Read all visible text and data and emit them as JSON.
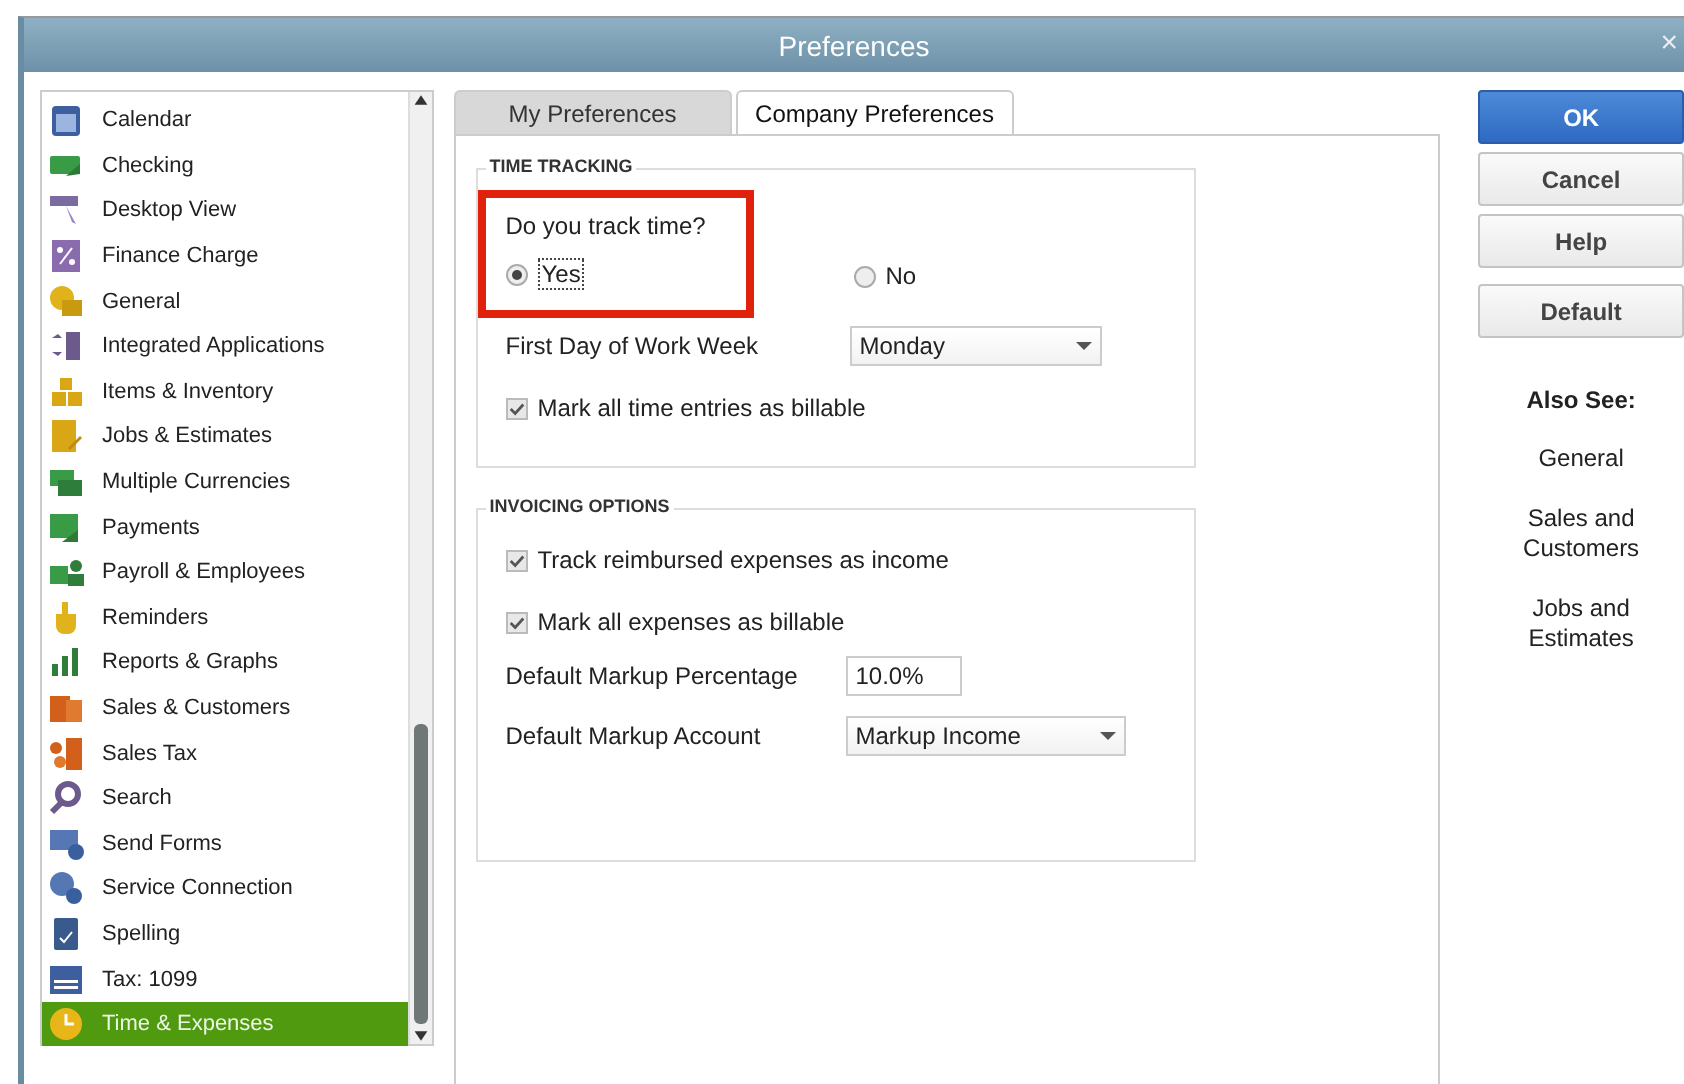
{
  "window": {
    "title": "Preferences",
    "close": "×"
  },
  "sidebar": {
    "items": [
      {
        "label": "Calendar",
        "selected": false
      },
      {
        "label": "Checking",
        "selected": false
      },
      {
        "label": "Desktop View",
        "selected": false
      },
      {
        "label": "Finance Charge",
        "selected": false
      },
      {
        "label": "General",
        "selected": false
      },
      {
        "label": "Integrated Applications",
        "selected": false
      },
      {
        "label": "Items & Inventory",
        "selected": false
      },
      {
        "label": "Jobs & Estimates",
        "selected": false
      },
      {
        "label": "Multiple Currencies",
        "selected": false
      },
      {
        "label": "Payments",
        "selected": false
      },
      {
        "label": "Payroll & Employees",
        "selected": false
      },
      {
        "label": "Reminders",
        "selected": false
      },
      {
        "label": "Reports & Graphs",
        "selected": false
      },
      {
        "label": "Sales & Customers",
        "selected": false
      },
      {
        "label": "Sales Tax",
        "selected": false
      },
      {
        "label": "Search",
        "selected": false
      },
      {
        "label": "Send Forms",
        "selected": false
      },
      {
        "label": "Service Connection",
        "selected": false
      },
      {
        "label": "Spelling",
        "selected": false
      },
      {
        "label": "Tax: 1099",
        "selected": false
      },
      {
        "label": "Time & Expenses",
        "selected": true
      }
    ]
  },
  "tabs": [
    {
      "label": "My Preferences",
      "selected": false
    },
    {
      "label": "Company Preferences",
      "selected": true
    }
  ],
  "time_tracking": {
    "title": "TIME TRACKING",
    "question": "Do you track time?",
    "highlighted": true,
    "options": [
      {
        "label": "Yes",
        "selected": true
      },
      {
        "label": "No",
        "selected": false
      }
    ],
    "first_day": {
      "label": "First Day of Work Week",
      "value": "Monday"
    },
    "billable": {
      "label": "Mark all time entries as billable",
      "checked": true
    }
  },
  "invoicing": {
    "title": "INVOICING OPTIONS",
    "checkboxes": [
      {
        "label": "Track reimbursed expenses as income",
        "checked": true
      },
      {
        "label": "Mark all expenses as billable",
        "checked": true
      }
    ],
    "markup_percentage": {
      "label": "Default Markup Percentage",
      "value": "10.0%"
    },
    "markup_account": {
      "label": "Default Markup Account",
      "value": "Markup Income"
    }
  },
  "buttons": [
    {
      "label": "OK",
      "primary": true
    },
    {
      "label": "Cancel",
      "primary": false
    },
    {
      "label": "Help",
      "primary": false
    },
    {
      "label": "Default",
      "primary": false
    }
  ],
  "also_see": {
    "title": "Also See:",
    "links": [
      "General",
      "Sales and Customers",
      "Jobs and Estimates"
    ]
  }
}
